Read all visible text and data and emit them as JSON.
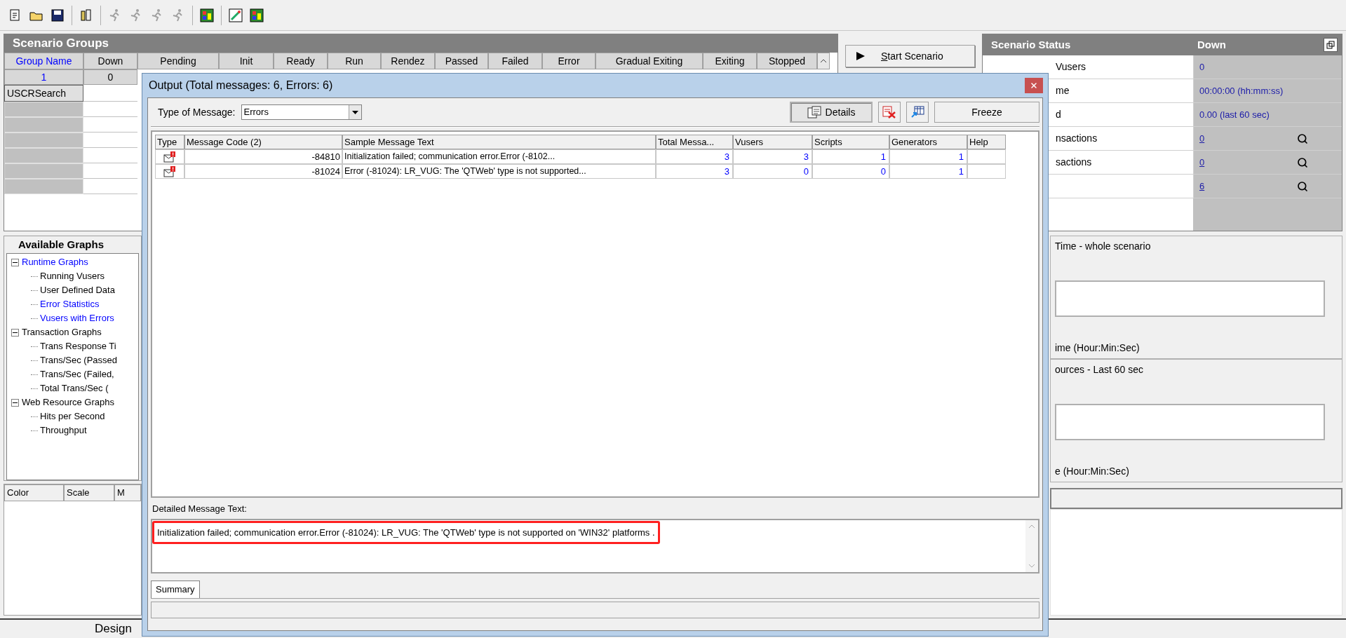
{
  "toolbar": [
    {
      "kind": "document",
      "disabled": false
    },
    {
      "kind": "folder",
      "disabled": false
    },
    {
      "kind": "disk",
      "disabled": false
    },
    {
      "kind": "hosts",
      "disabled": false
    },
    {
      "kind": "runner",
      "disabled": true
    },
    {
      "kind": "runner",
      "disabled": true
    },
    {
      "kind": "runner",
      "disabled": true
    },
    {
      "kind": "runner",
      "disabled": true
    },
    {
      "kind": "grid",
      "disabled": false
    },
    {
      "kind": "wand",
      "disabled": false
    },
    {
      "kind": "grid",
      "disabled": false
    }
  ],
  "scenario_groups": {
    "title": "Scenario Groups",
    "columns": [
      {
        "label": "Group Name",
        "active": true
      },
      {
        "label": "Down",
        "active": false
      },
      {
        "label": "Pending",
        "active": false
      },
      {
        "label": "Init",
        "active": false
      },
      {
        "label": "Ready",
        "active": false
      },
      {
        "label": "Run",
        "active": false
      },
      {
        "label": "Rendez",
        "active": false
      },
      {
        "label": "Passed",
        "active": false
      },
      {
        "label": "Failed",
        "active": false
      },
      {
        "label": "Error",
        "active": false
      },
      {
        "label": "Gradual Exiting",
        "active": false
      },
      {
        "label": "Exiting",
        "active": false
      },
      {
        "label": "Stopped",
        "active": false
      }
    ],
    "totals": [
      "1",
      "0"
    ],
    "groups": [
      "USCRSearch"
    ]
  },
  "start_button": "Start Scenario",
  "scenario_status": {
    "title": "Scenario Status",
    "state": "Down",
    "rows": [
      {
        "label": "Vusers",
        "value": "0",
        "link": false
      },
      {
        "label": "me",
        "value": "00:00:00 (hh:mm:ss)",
        "link": false
      },
      {
        "label": "d",
        "value": "0.00 (last 60 sec)",
        "link": false
      },
      {
        "label": "nsactions",
        "value": "0",
        "link": true
      },
      {
        "label": "sactions",
        "value": "0",
        "link": true
      },
      {
        "value": "6",
        "link": true
      }
    ]
  },
  "available_graphs": {
    "title": "Available Graphs",
    "tree": [
      {
        "label": "Runtime Graphs",
        "highlighted": true,
        "expanded": true,
        "children": [
          {
            "label": "Running Vusers",
            "highlighted": false
          },
          {
            "label": "User Defined Data",
            "highlighted": false
          },
          {
            "label": "Error Statistics",
            "highlighted": true
          },
          {
            "label": "Vusers with Errors",
            "highlighted": true
          }
        ]
      },
      {
        "label": "Transaction Graphs",
        "highlighted": false,
        "expanded": true,
        "children": [
          {
            "label": "Trans Response Ti",
            "highlighted": false
          },
          {
            "label": "Trans/Sec (Passed",
            "highlighted": false
          },
          {
            "label": "Trans/Sec (Failed,",
            "highlighted": false
          },
          {
            "label": "Total Trans/Sec (",
            "highlighted": false
          }
        ]
      },
      {
        "label": "Web Resource Graphs",
        "highlighted": false,
        "expanded": true,
        "children": [
          {
            "label": "Hits per Second",
            "highlighted": false
          },
          {
            "label": "Throughput",
            "highlighted": false
          }
        ]
      }
    ]
  },
  "legend_columns": [
    "Color",
    "Scale",
    "M"
  ],
  "graph_panels": [
    {
      "title": "Time - whole scenario",
      "axis": "ime (Hour:Min:Sec)"
    },
    {
      "title": "ources - Last 60 sec",
      "axis": "e (Hour:Min:Sec)"
    }
  ],
  "status_bar": {
    "tab": "Design"
  },
  "output_dialog": {
    "title": "Output (Total messages: 6,  Errors: 6)",
    "type_of_message": {
      "label": "Type of Message:",
      "value": "Errors"
    },
    "details_button": {
      "label": "Details",
      "pressed": true
    },
    "freeze_button": "Freeze",
    "columns": [
      "Type",
      "Message Code (2)",
      "Sample Message Text",
      "Total Messa...",
      "Vusers",
      "Scripts",
      "Generators",
      "Help"
    ],
    "rows": [
      {
        "code": "-84810",
        "text": "Initialization failed; communication error.Error (-8102...",
        "total": "3",
        "vusers": "3",
        "scripts": "1",
        "generators": "1"
      },
      {
        "code": "-81024",
        "text": "Error (-81024): LR_VUG: The 'QTWeb' type is not supported...",
        "total": "3",
        "vusers": "0",
        "scripts": "0",
        "generators": "1"
      }
    ],
    "detail": {
      "label": "Detailed Message Text:",
      "value": "Initialization failed; communication error.Error (-81024): LR_VUG: The 'QTWeb' type is not supported on 'WIN32' platforms .",
      "highlighted": true
    },
    "tabs": [
      {
        "label": "Summary",
        "selected": true
      }
    ]
  }
}
